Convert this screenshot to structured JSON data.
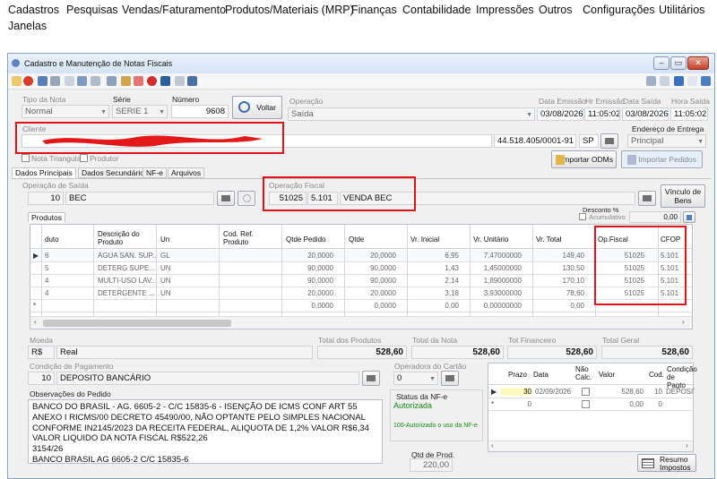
{
  "menu": [
    "Cadastros",
    "Pesquisas",
    "Vendas/Faturamento",
    "Produtos/Materiais (MRP)",
    "Finanças",
    "Contabilidade",
    "Impressões",
    "Outros",
    "Configurações",
    "Utilitários",
    "Janelas"
  ],
  "window": {
    "title": "Cadastro e Manutenção de Notas Fiscais"
  },
  "header": {
    "tipo_label": "Tipo da Nota",
    "tipo_value": "Normal",
    "serie_label": "Série",
    "serie_value": "SERIE 1",
    "numero_label": "Número",
    "numero_value": "9608",
    "voltar_label": "Voltar",
    "operacao_label": "Operação",
    "operacao_value": "Saída",
    "data_emissao_label": "Data Emissão",
    "data_emissao_value": "03/08/2026",
    "hr_emissao_label": "Hr Emissão",
    "hr_emissao_value": "11:05:02",
    "data_saida_label": "Data Saída",
    "data_saida_value": "03/08/2026",
    "hora_saida_label": "Hora Saída",
    "hora_saida_value": "11:05:02"
  },
  "cliente": {
    "label": "Cliente",
    "cnpj": "44.518.405/0001-91",
    "uf": "SP",
    "endereco_label": "Endereço de Entrega",
    "endereco_value": "Principal",
    "nota_triangular": "Nota Triangular",
    "produtor": "Produtor",
    "importar_odms": "Importar ODMs",
    "importar_pedidos": "Importar Pedidos"
  },
  "tabs": [
    "Dados Principais",
    "Dados Secundários",
    "NF-e",
    "Arquivos"
  ],
  "operacao_saida": {
    "label": "Operação de Saída",
    "code": "10",
    "name": "BEC"
  },
  "operacao_fiscal": {
    "label": "Operação Fiscal",
    "code": "51025",
    "cfop": "5.101",
    "name": "VENDA BEC"
  },
  "vinculo": "Vínculo de Bens",
  "desconto": {
    "label": "Desconto %",
    "acumulativo": "Acumulativo",
    "value": "0,00"
  },
  "produtos": {
    "tab_label": "Produtos",
    "columns": [
      "duto",
      "Descrição do Produto",
      "Un",
      "Cod. Ref. Produto",
      "Qtde Pedido",
      "Qtde",
      "Vr. Inicial",
      "Vr. Unitário",
      "Vr. Total",
      "Op.Fiscal",
      "CFOP"
    ],
    "rows": [
      {
        "cod": "6",
        "desc": "AGUA SAN. SUP...",
        "un": "GL",
        "qp": "20,0000",
        "q": "20,0000",
        "vi": "6,95",
        "vu": "7,47000000",
        "vt": "149,40",
        "op": "51025",
        "cfop": "5.101"
      },
      {
        "cod": "5",
        "desc": "DETERG SUPE...",
        "un": "UN",
        "qp": "90,0000",
        "q": "90,0000",
        "vi": "1,43",
        "vu": "1,45000000",
        "vt": "130,50",
        "op": "51025",
        "cfop": "5.101"
      },
      {
        "cod": "4",
        "desc": "MULTI-USO LAV...",
        "un": "UN",
        "qp": "90,0000",
        "q": "90,0000",
        "vi": "2,14",
        "vu": "1,89000000",
        "vt": "170,10",
        "op": "51025",
        "cfop": "5.101"
      },
      {
        "cod": "4",
        "desc": "DETERGENTE ...",
        "un": "UN",
        "qp": "20,0000",
        "q": "20,0000",
        "vi": "3,18",
        "vu": "3,93000000",
        "vt": "78,60",
        "op": "51025",
        "cfop": "5.101"
      },
      {
        "cod": "",
        "desc": "",
        "un": "",
        "qp": "0,0000",
        "q": "0,0000",
        "vi": "0,00",
        "vu": "0,00000000",
        "vt": "0,00",
        "op": "",
        "cfop": ""
      }
    ]
  },
  "totals": {
    "moeda_label": "Moeda",
    "moeda_symbol": "R$",
    "moeda_name": "Real",
    "total_produtos_label": "Total dos Produtos",
    "total_produtos": "528,60",
    "total_nota_label": "Total da Nota",
    "total_nota": "528,60",
    "tot_financeiro_label": "Tot Financeiro",
    "tot_financeiro": "528,60",
    "total_geral_label": "Total Geral",
    "total_geral": "528,60"
  },
  "pagamento": {
    "label": "Condição de Pagamento",
    "code": "10",
    "name": "DEPOSITO BANCÁRIO",
    "operadora_label": "Operadora do Cartão",
    "operadora_value": "0"
  },
  "observacoes": {
    "label": "Observações do Pedido",
    "lines": [
      "BANCO DO BRASIL - AG. 6605-2 - C/C 15835-6 -             ISENÇÃO DE ICMS CONF ART 55",
      "ANEXO I RICMS/00 DECRETO 45490/00, NÃO OPTANTE PELO SIMPLES NACIONAL",
      "CONFORME IN2145/2023 DA RECEITA FEDERAL, ALIQUOTA DE 1,2% VALOR R$6,34",
      "VALOR LIQUIDO DA NOTA FISCAL R$522,26",
      "3154/26",
      "BANCO BRASIL AG 6605-2 C/C 15835-6"
    ]
  },
  "nfe_status": {
    "label": "Status da NF-e",
    "value": "Autorizada",
    "message": "100-Autorizado o uso da NF-e",
    "qtd_prod_label": "Qtd de Prod.",
    "qtd_prod_value": "220,00"
  },
  "parcelas": {
    "columns": [
      "Prazo",
      "Data",
      "Não Calc.",
      "Valor",
      "Cod.",
      "Condição de Pagto"
    ],
    "rows": [
      {
        "prazo": "30",
        "data": "02/09/2026",
        "valor": "528,60",
        "cod": "10",
        "cond": "DEPOSITO"
      },
      {
        "prazo": "0",
        "data": "",
        "valor": "0,00",
        "cod": "0",
        "cond": ""
      }
    ]
  },
  "resumo_impostos": "Resumo Impostos",
  "colors": {
    "highlight_red": "#e0121a",
    "title_gradient_top": "#eaf1fb"
  }
}
